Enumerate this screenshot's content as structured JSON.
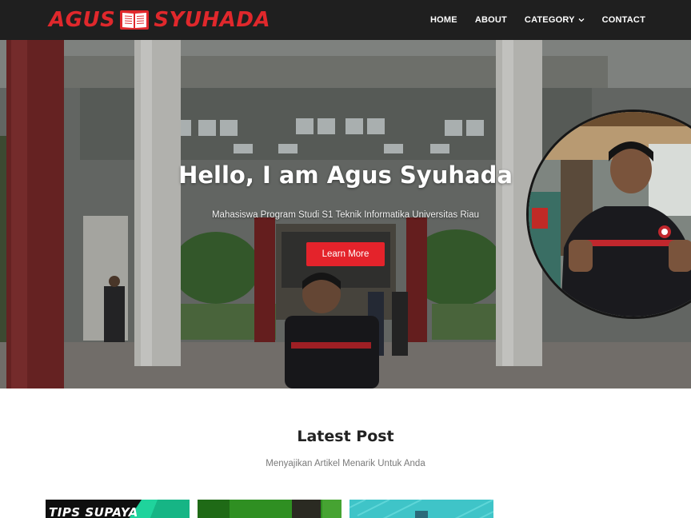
{
  "brand": {
    "part1": "AGUS",
    "part2": "SYUHADA",
    "logo_icon": "open-book-icon"
  },
  "nav": {
    "items": [
      {
        "label": "HOME"
      },
      {
        "label": "ABOUT"
      },
      {
        "label": "CATEGORY",
        "icon": "chevron-down-icon"
      },
      {
        "label": "CONTACT"
      }
    ]
  },
  "hero": {
    "title": "Hello, I am Agus Syuhada",
    "subtitle": "Mahasiswa Program Studi S1 Teknik Informatika Universitas Riau",
    "button_label": "Learn More"
  },
  "latest": {
    "title": "Latest Post",
    "subtitle": "Menyajikan Artikel Menarik Untuk Anda",
    "cards": [
      {
        "visible_text": "TIPS SUPAYA"
      },
      {
        "visible_text": ""
      },
      {
        "visible_text": ""
      }
    ]
  },
  "colors": {
    "navbar_bg": "#1f1f1f",
    "brand_red": "#e0282c",
    "accent_button": "#e4232b",
    "heading_text": "#222222",
    "muted_text": "#7a7a7a"
  }
}
